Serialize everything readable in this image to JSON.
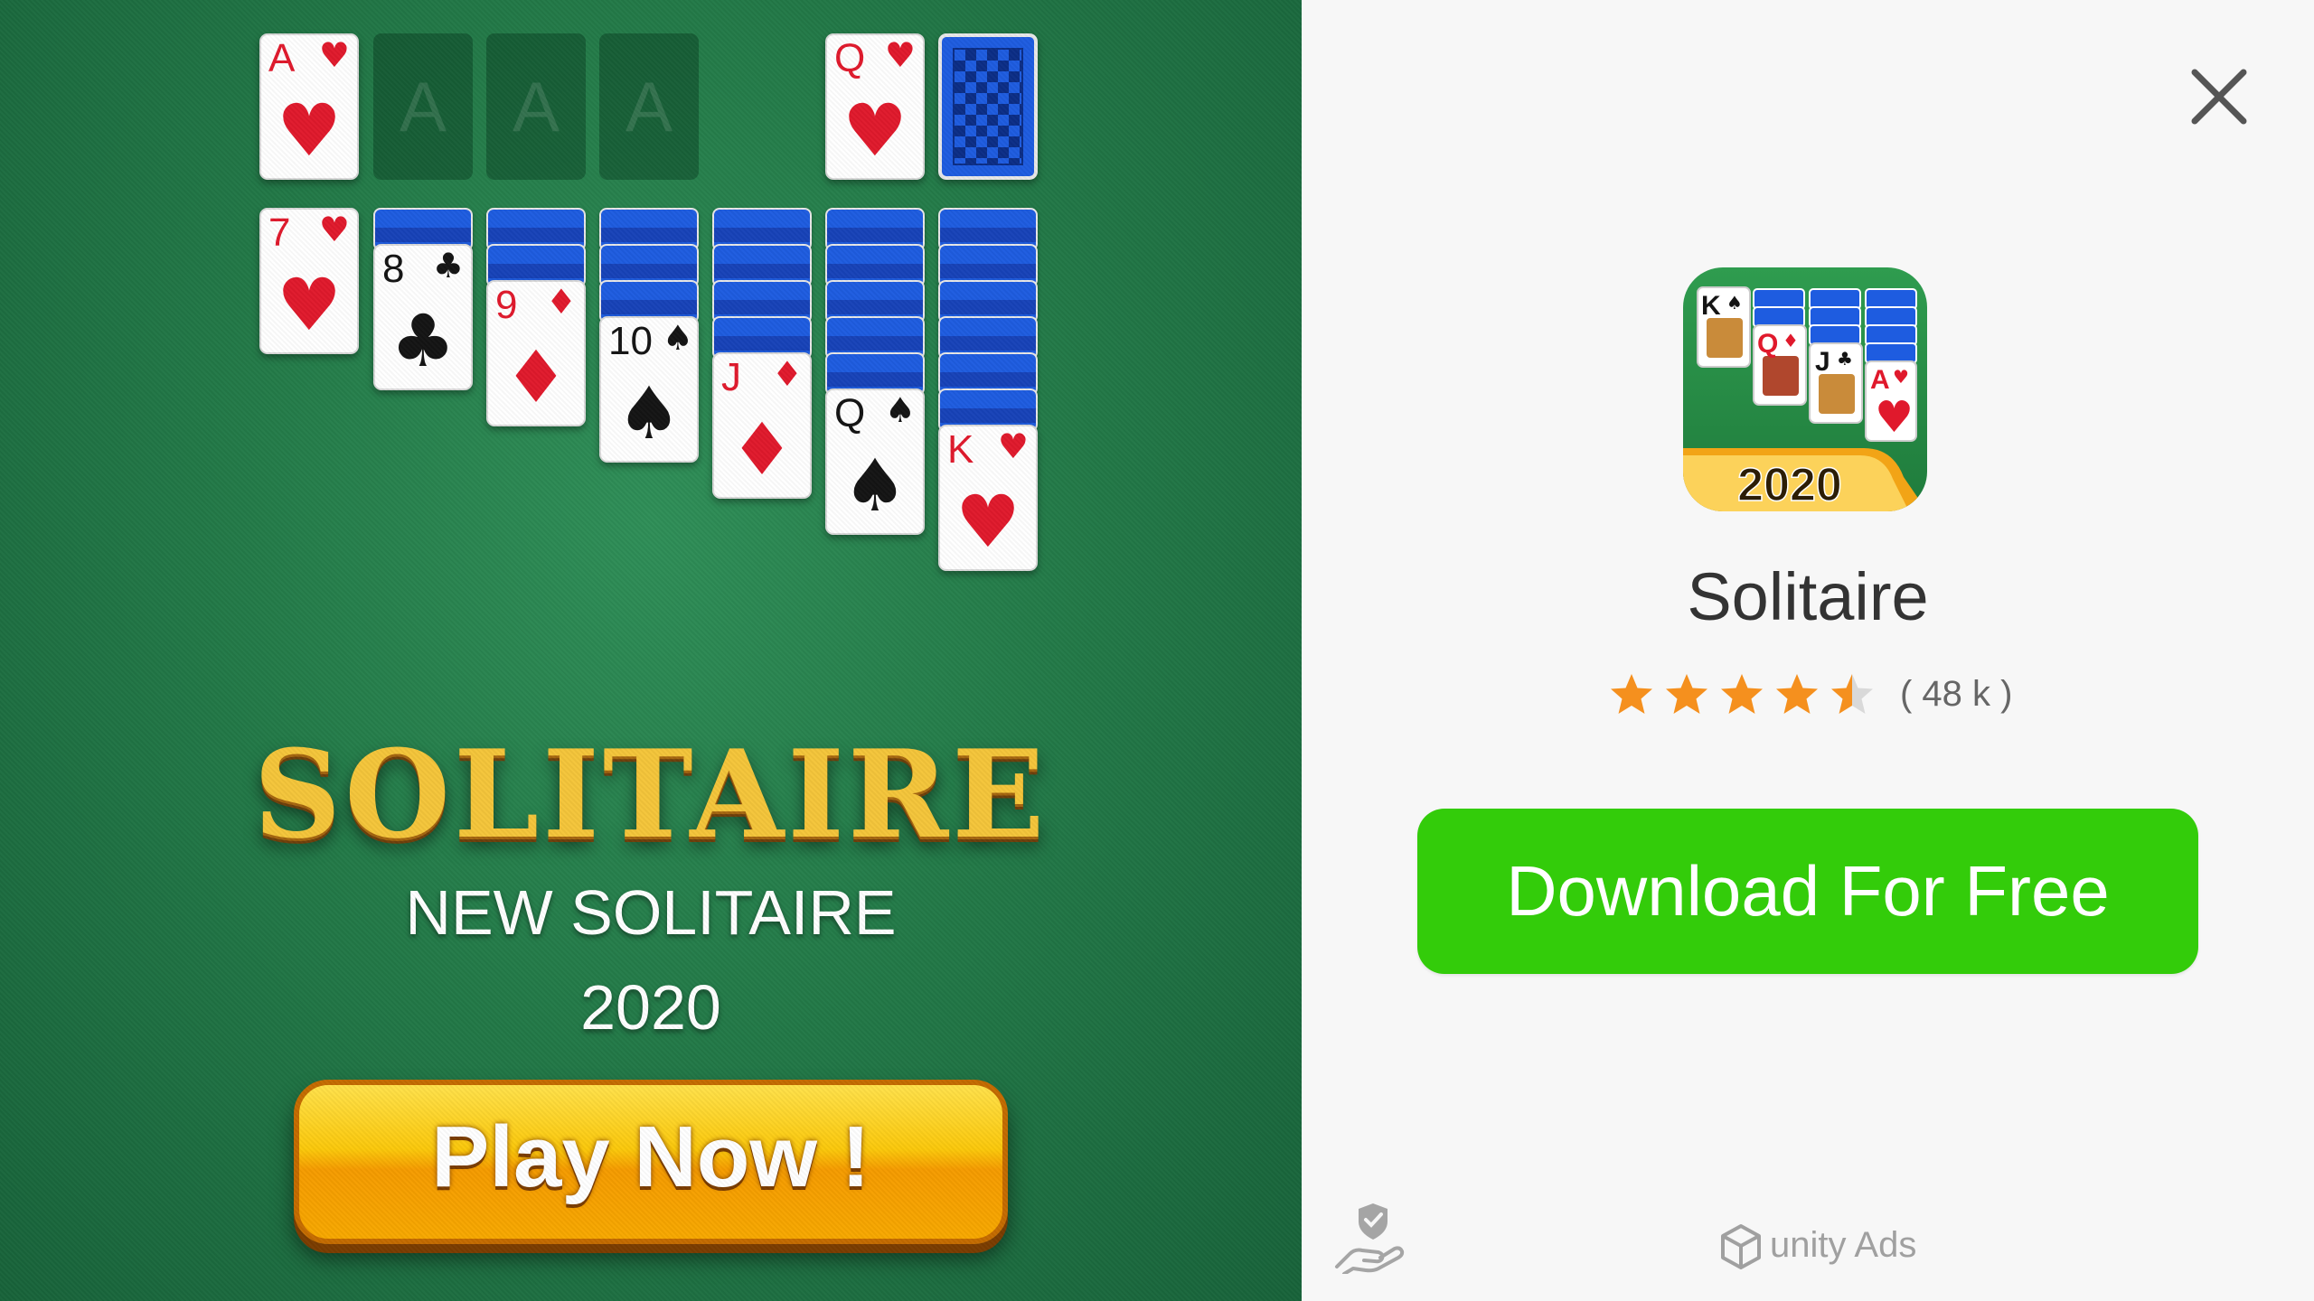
{
  "ad_creative": {
    "foundation_top": {
      "rank": "A",
      "suit": "♥"
    },
    "empty_foundation_letter": "A",
    "waste_card": {
      "rank": "Q",
      "suit": "♥"
    },
    "tableau": [
      {
        "rank": "7",
        "suit": "♥"
      },
      {
        "rank": "8",
        "suit": "♣"
      },
      {
        "rank": "9",
        "suit": "♦"
      },
      {
        "rank": "10",
        "suit": "♠"
      },
      {
        "rank": "J",
        "suit": "♦"
      },
      {
        "rank": "Q",
        "suit": "♠"
      },
      {
        "rank": "K",
        "suit": "♥"
      }
    ],
    "game_title": "SOLITAIRE",
    "subtitle_line1": "NEW SOLITAIRE",
    "subtitle_line2": "2020",
    "play_button_label": "Play Now !"
  },
  "app": {
    "name": "Solitaire",
    "icon_year": "2020",
    "icon_cards": [
      {
        "rank": "K",
        "suit": "♠"
      },
      {
        "rank": "Q",
        "suit": "♦"
      },
      {
        "rank": "J",
        "suit": "♣"
      },
      {
        "rank": "A",
        "suit": "♥"
      }
    ],
    "rating_value": 4.5,
    "rating_max": 5,
    "rating_count": "( 48 k )",
    "download_label": "Download For Free"
  },
  "footer": {
    "network_label": "unity Ads"
  },
  "icons": {
    "close": "close-icon",
    "privacy": "privacy-hand-shield-icon",
    "unity": "unity-logo-icon",
    "star": "star-icon"
  },
  "colors": {
    "felt_green": "#237a48",
    "download_green": "#33cc0a",
    "star_orange": "#f5901e",
    "play_button_yellow": "#fbc80a",
    "card_red": "#e0192c",
    "card_back_blue": "#1e5ce0"
  }
}
